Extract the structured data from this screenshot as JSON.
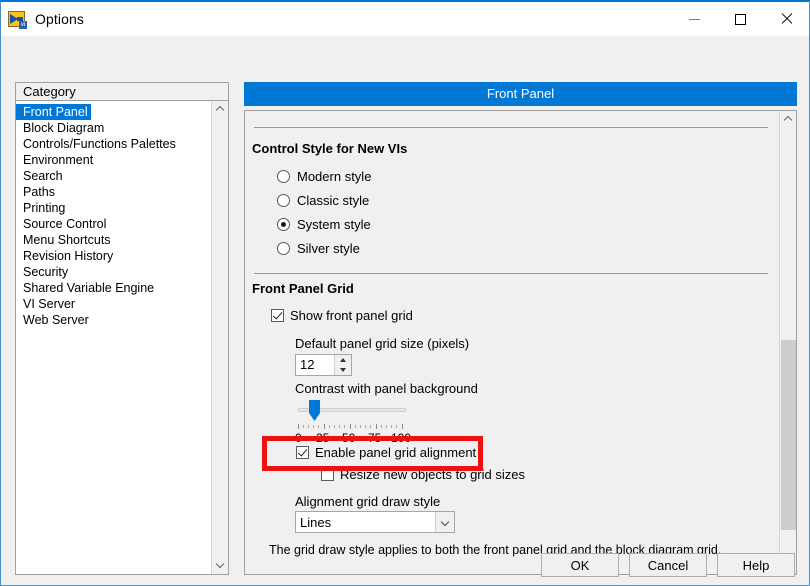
{
  "window": {
    "title": "Options",
    "icon": "labview-options-icon",
    "controls": {
      "minimize": "minimize-icon",
      "maximize": "maximize-icon",
      "close": "close-icon"
    }
  },
  "category": {
    "header": "Category",
    "selected": "Front Panel",
    "items": [
      "Front Panel",
      "Block Diagram",
      "Controls/Functions Palettes",
      "Environment",
      "Search",
      "Paths",
      "Printing",
      "Source Control",
      "Menu Shortcuts",
      "Revision History",
      "Security",
      "Shared Variable Engine",
      "VI Server",
      "Web Server"
    ]
  },
  "pane": {
    "header": "Front Panel",
    "control_style": {
      "title": "Control Style for New VIs",
      "options": [
        {
          "label": "Modern style",
          "checked": false
        },
        {
          "label": "Classic style",
          "checked": false
        },
        {
          "label": "System style",
          "checked": true
        },
        {
          "label": "Silver style",
          "checked": false
        }
      ]
    },
    "front_panel_grid": {
      "title": "Front Panel Grid",
      "show_grid": {
        "label": "Show front panel grid",
        "checked": true
      },
      "grid_size": {
        "label": "Default panel grid size (pixels)",
        "value": "12"
      },
      "contrast": {
        "label": "Contrast with panel background",
        "value": 12,
        "min": 0,
        "max": 100,
        "tick_labels": [
          "0",
          "25",
          "50",
          "75",
          "100"
        ]
      },
      "enable_alignment": {
        "label": "Enable panel grid alignment",
        "checked": true
      },
      "resize_objects": {
        "label": "Resize new objects to grid sizes",
        "checked": false
      },
      "draw_style": {
        "label": "Alignment grid draw style",
        "value": "Lines"
      },
      "hint": "The grid draw style applies to both the front panel grid and the block diagram grid."
    }
  },
  "buttons": {
    "ok": "OK",
    "cancel": "Cancel",
    "help": "Help"
  },
  "colors": {
    "accent": "#0078d4",
    "selection": "#0078d7",
    "highlight": "#ee1111",
    "window_bg": "#f0f0f0"
  }
}
